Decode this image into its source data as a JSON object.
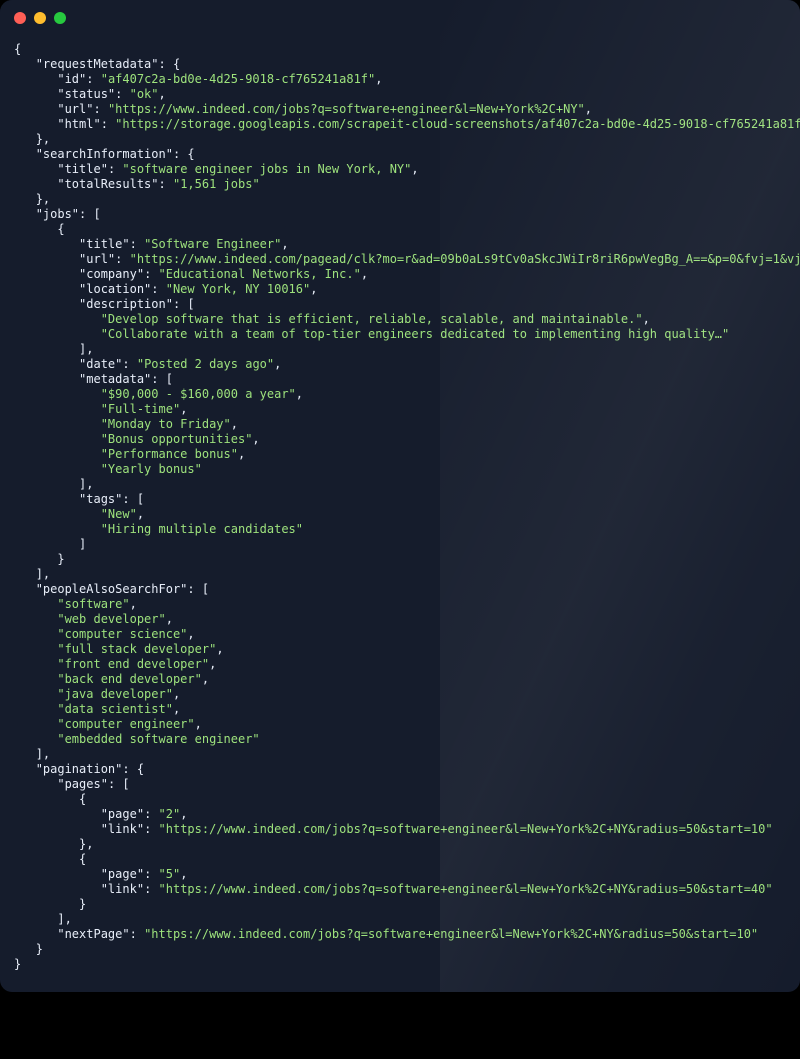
{
  "json": {
    "requestMetadata": {
      "id": "af407c2a-bd0e-4d25-9018-cf765241a81f",
      "status": "ok",
      "url": "https://www.indeed.com/jobs?q=software+engineer&l=New+York%2C+NY",
      "html": "https://storage.googleapis.com/scrapeit-cloud-screenshots/af407c2a-bd0e-4d25-9018-cf765241a81f.html"
    },
    "searchInformation": {
      "title": "software engineer jobs in New York, NY",
      "totalResults": "1,561 jobs"
    },
    "jobs": [
      {
        "title": "Software Engineer",
        "url": "https://www.indeed.com/pagead/clk?mo=r&ad=09b0aLs9tCv0aSkcJWiIr8riR6pwVegBg_A==&p=0&fvj=1&vjs=3",
        "company": "Educational Networks, Inc.",
        "location": "New York, NY 10016",
        "description": [
          "Develop software that is efficient, reliable, scalable, and maintainable.",
          "Collaborate with a team of top-tier engineers dedicated to implementing high quality…"
        ],
        "date": "Posted 2 days ago",
        "metadata": [
          "$90,000 - $160,000 a year",
          "Full-time",
          "Monday to Friday",
          "Bonus opportunities",
          "Performance bonus",
          "Yearly bonus"
        ],
        "tags": [
          "New",
          "Hiring multiple candidates"
        ]
      }
    ],
    "peopleAlsoSearchFor": [
      "software",
      "web developer",
      "computer science",
      "full stack developer",
      "front end developer",
      "back end developer",
      "java developer",
      "data scientist",
      "computer engineer",
      "embedded software engineer"
    ],
    "pagination": {
      "pages": [
        {
          "page": "2",
          "link": "https://www.indeed.com/jobs?q=software+engineer&l=New+York%2C+NY&radius=50&start=10"
        },
        {
          "page": "5",
          "link": "https://www.indeed.com/jobs?q=software+engineer&l=New+York%2C+NY&radius=50&start=40"
        }
      ],
      "nextPage": "https://www.indeed.com/jobs?q=software+engineer&l=New+York%2C+NY&radius=50&start=10"
    }
  }
}
